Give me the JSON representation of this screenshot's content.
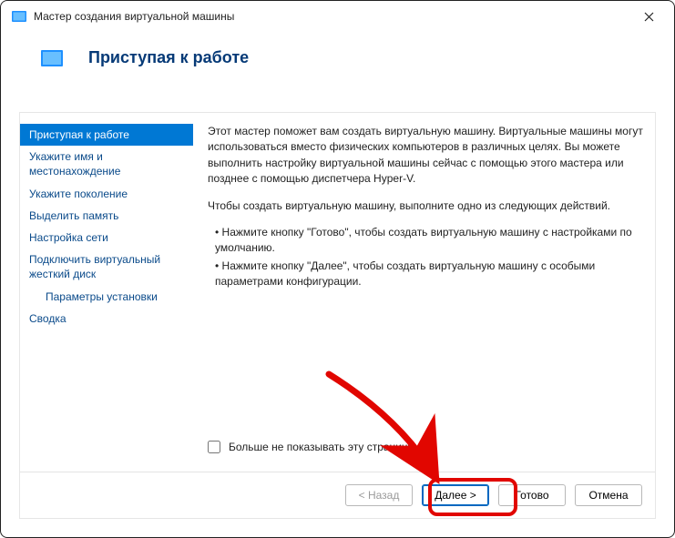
{
  "window": {
    "title": "Мастер создания виртуальной машины"
  },
  "header": {
    "heading": "Приступая к работе"
  },
  "sidebar": {
    "items": [
      {
        "label": "Приступая к работе",
        "active": true
      },
      {
        "label": "Укажите имя и местонахождение"
      },
      {
        "label": "Укажите поколение"
      },
      {
        "label": "Выделить память"
      },
      {
        "label": "Настройка сети"
      },
      {
        "label": "Подключить виртуальный жесткий диск"
      },
      {
        "label": "Параметры установки",
        "sub": true
      },
      {
        "label": "Сводка"
      }
    ]
  },
  "content": {
    "p1": "Этот мастер поможет вам создать виртуальную машину. Виртуальные машины могут использоваться вместо физических компьютеров в различных целях. Вы можете выполнить настройку виртуальной машины сейчас с помощью этого мастера или позднее с помощью диспетчера Hyper-V.",
    "p2": "Чтобы создать виртуальную машину, выполните одно из следующих действий.",
    "li1": "Нажмите кнопку \"Готово\", чтобы создать виртуальную машину с настройками по умолчанию.",
    "li2": "Нажмите кнопку \"Далее\", чтобы создать виртуальную машину с особыми параметрами конфигурации."
  },
  "checkbox": {
    "label": "Больше не показывать эту страницу"
  },
  "buttons": {
    "back": "< Назад",
    "next": "Далее >",
    "finish": "Готово",
    "cancel": "Отмена"
  }
}
